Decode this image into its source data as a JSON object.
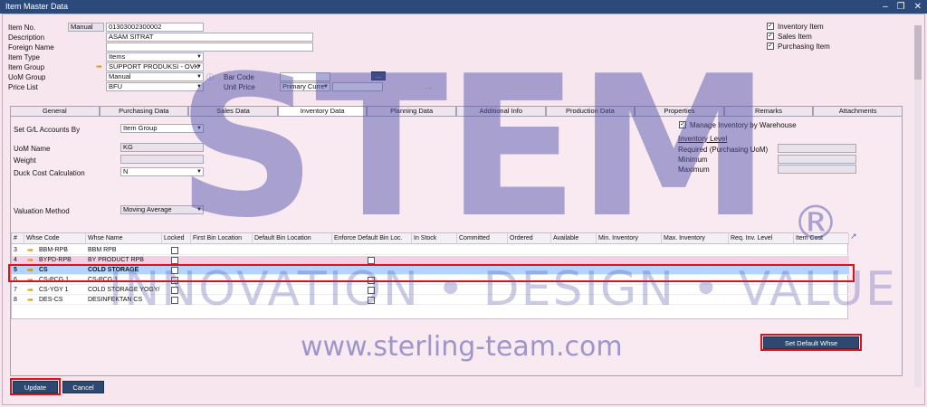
{
  "window": {
    "title": "Item Master Data"
  },
  "header": {
    "item_no_label": "Item No.",
    "item_no_series": "Manual",
    "item_no_value": "01303002300002",
    "description_label": "Description",
    "description_value": "ASAM SITRAT",
    "foreign_name_label": "Foreign Name",
    "foreign_name_value": "",
    "item_type_label": "Item Type",
    "item_type_value": "Items",
    "item_group_label": "Item Group",
    "item_group_value": "SUPPORT PRODUKSI - OVK",
    "uom_group_label": "UoM Group",
    "uom_group_value": "Manual",
    "price_list_label": "Price List",
    "price_list_value": "BFU",
    "bar_code_label": "Bar Code",
    "bar_code_value": "",
    "bar_code_btn": "...",
    "unit_price_label": "Unit Price",
    "unit_price_currency": "Primary Curre",
    "unit_price_value": "",
    "unit_price_btn": "...",
    "inventory_item_label": "Inventory Item",
    "sales_item_label": "Sales Item",
    "purchasing_item_label": "Purchasing Item"
  },
  "tabs": [
    "General",
    "Purchasing Data",
    "Sales Data",
    "Inventory Data",
    "Planning Data",
    "Additional Info",
    "Production Data",
    "Properties",
    "Remarks",
    "Attachments"
  ],
  "inventory": {
    "gl_label": "Set G/L Accounts By",
    "gl_value": "Item Group",
    "uom_name_label": "UoM Name",
    "uom_name_value": "KG",
    "weight_label": "Weight",
    "weight_value": "",
    "duck_label": "Duck Cost Calculation",
    "duck_value": "N",
    "valuation_label": "Valuation Method",
    "valuation_value": "Moving Average",
    "manage_label": "Manage Inventory by Warehouse",
    "level_title": "Inventory Level",
    "required_label": "Required (Purchasing UoM)",
    "minimum_label": "Minimum",
    "maximum_label": "Maximum"
  },
  "grid": {
    "headers": [
      "#",
      "Whse Code",
      "Whse Name",
      "Locked",
      "First Bin Location",
      "Default Bin Location",
      "Enforce Default Bin Loc.",
      "In Stock",
      "Committed",
      "Ordered",
      "Available",
      "Min. Inventory",
      "Max. Inventory",
      "Req. Inv. Level",
      "Item Cost"
    ],
    "rows": [
      {
        "num": "3",
        "code": "BBM-RPB",
        "name": "BBM RPB"
      },
      {
        "num": "4",
        "code": "BYPD-RPB",
        "name": "BY PRODUCT RPB"
      },
      {
        "num": "5",
        "code": "CS",
        "name": "COLD STORAGE"
      },
      {
        "num": "6",
        "code": "CS-PCG 1",
        "name": "CS-PCG 1"
      },
      {
        "num": "7",
        "code": "CS-YGY 1",
        "name": "COLD STORAGE YOGY/"
      },
      {
        "num": "8",
        "code": "DES-CS",
        "name": "DESINFEKTAN CS"
      }
    ]
  },
  "buttons": {
    "set_default": "Set Default Whse",
    "update": "Update",
    "cancel": "Cancel"
  },
  "watermark": {
    "letters": "STEM",
    "reg": "®",
    "tagline": "INNOVATION • DESIGN • VALUE",
    "url": "www.sterling-team.com"
  }
}
